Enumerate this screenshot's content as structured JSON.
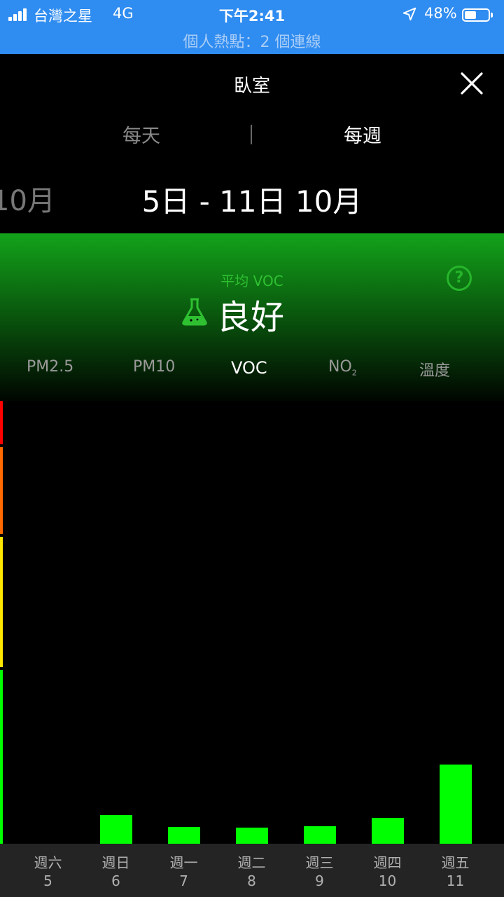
{
  "status_bar": {
    "carrier": "台灣之星",
    "network": "4G",
    "time": "下午2:41",
    "battery": "48%",
    "battery_level": 0.48,
    "hotspot": "個人熱點：2 個連線"
  },
  "header": {
    "title": "臥室",
    "close_icon": "close-icon"
  },
  "tabs": {
    "daily": "每天",
    "weekly": "每週",
    "active": "weekly"
  },
  "period": {
    "previous": "10月",
    "current": "5日 - 11日 10月"
  },
  "summary": {
    "avg_label": "平均 VOC",
    "quality": "良好",
    "icon": "flask-icon",
    "help_icon": "help-icon",
    "color": "#13a31a"
  },
  "metrics": [
    {
      "key": "pm25",
      "label": "PM2.5"
    },
    {
      "key": "pm10",
      "label": "PM10"
    },
    {
      "key": "voc",
      "label": "VOC",
      "active": true
    },
    {
      "key": "no2",
      "label": "NO",
      "sub": "2"
    },
    {
      "key": "temp",
      "label": "溫度"
    }
  ],
  "scale_colors": [
    "#ff0000",
    "#ff6a00",
    "#ffe600",
    "#00ff00"
  ],
  "chart_data": {
    "type": "bar",
    "categories": [
      "週六 5",
      "週日 6",
      "週一 7",
      "週二 8",
      "週三 9",
      "週四 10",
      "週五 11"
    ],
    "values": [
      0,
      41,
      24,
      23,
      25,
      37,
      113
    ],
    "ylim": [
      0,
      630
    ],
    "bar_color": "#00ff00"
  },
  "days": [
    {
      "weekday": "週六",
      "date": "5"
    },
    {
      "weekday": "週日",
      "date": "6"
    },
    {
      "weekday": "週一",
      "date": "7"
    },
    {
      "weekday": "週二",
      "date": "8"
    },
    {
      "weekday": "週三",
      "date": "9"
    },
    {
      "weekday": "週四",
      "date": "10"
    },
    {
      "weekday": "週五",
      "date": "11"
    }
  ]
}
